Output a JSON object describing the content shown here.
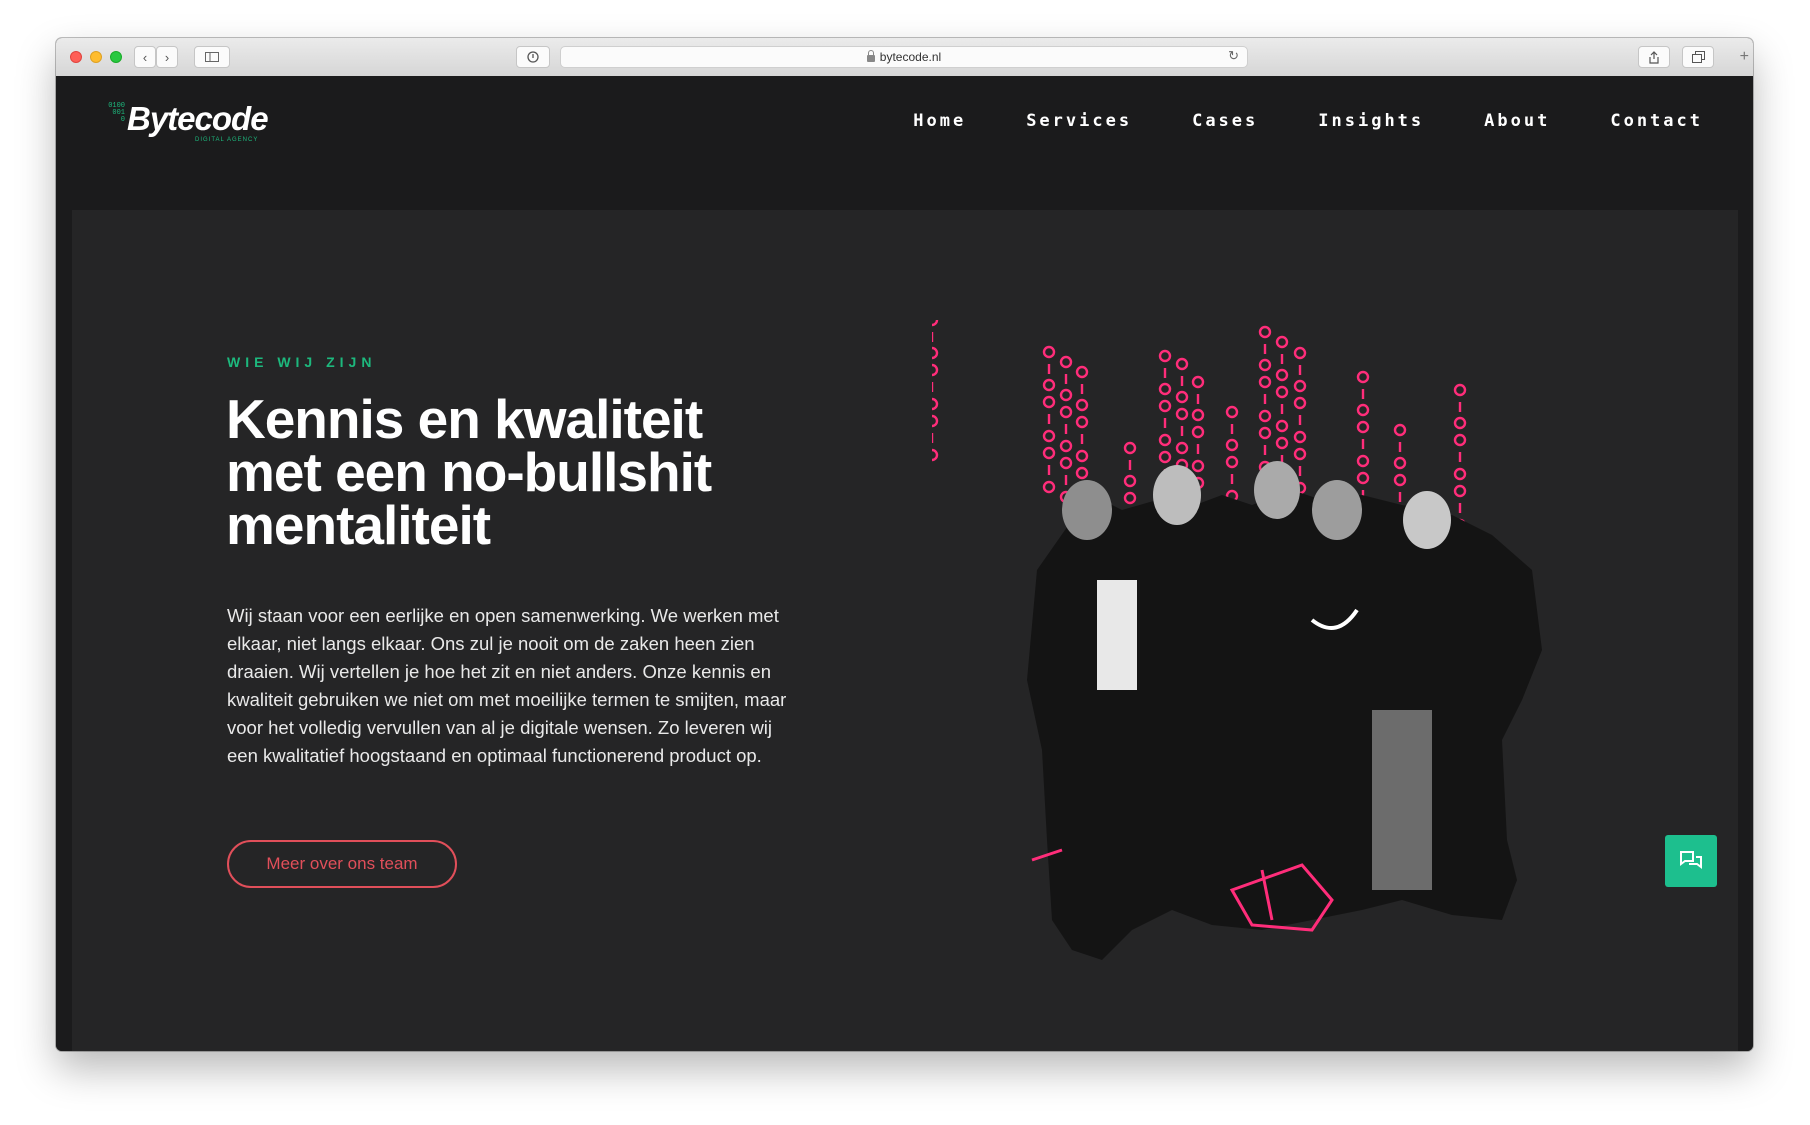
{
  "browser": {
    "url": "bytecode.nl"
  },
  "brand": {
    "name": "Bytecode",
    "tagline": "DIGITAL AGENCY",
    "binary": "0100\n001\n0",
    "accent_color": "#1db87d",
    "cta_color": "#e14f5a",
    "binary_art_color": "#ff2d7a"
  },
  "nav": {
    "items": [
      {
        "label": "Home"
      },
      {
        "label": "Services"
      },
      {
        "label": "Cases"
      },
      {
        "label": "Insights"
      },
      {
        "label": "About"
      },
      {
        "label": "Contact"
      }
    ]
  },
  "hero": {
    "eyebrow": "WIE WIJ ZIJN",
    "headline": "Kennis en kwaliteit met een no-bullshit mentaliteit",
    "body": "Wij staan voor een eerlijke en open samenwerking. We werken met elkaar, niet langs elkaar. Ons zul je nooit om de zaken heen zien draaien. Wij vertellen je hoe het zit en niet anders. Onze kennis en kwaliteit gebruiken we niet om met moeilijke termen te smijten, maar voor het volledig vervullen van al je digitale wensen. Zo leveren wij een kwalitatief hoogstaand en optimaal functionerend product op.",
    "cta_label": "Meer over ons team",
    "image_icon": "team-photo-icon"
  },
  "chat": {
    "icon": "chat-icon"
  }
}
